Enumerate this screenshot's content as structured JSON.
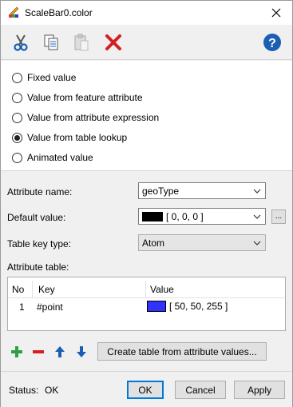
{
  "window": {
    "title": "ScaleBar0.color",
    "close_icon": "close-icon"
  },
  "toolbar": {
    "cut_icon": "scissors-icon",
    "copy_icon": "copy-icon",
    "paste_icon": "paste-icon",
    "delete_icon": "red-x-icon",
    "help_icon": "help-icon"
  },
  "value_source": {
    "options": [
      {
        "label": "Fixed value",
        "checked": false
      },
      {
        "label": "Value from feature attribute",
        "checked": false
      },
      {
        "label": "Value from attribute expression",
        "checked": false
      },
      {
        "label": "Value from table lookup",
        "checked": true
      },
      {
        "label": "Animated value",
        "checked": false
      }
    ]
  },
  "params": {
    "attribute_name_label": "Attribute name:",
    "attribute_name_value": "geoType",
    "default_value_label": "Default value:",
    "default_value_text": "[ 0, 0, 0 ]",
    "default_value_color": "#000000",
    "default_value_more": "...",
    "table_key_type_label": "Table key type:",
    "table_key_type_value": "Atom",
    "attribute_table_label": "Attribute table:"
  },
  "table": {
    "headers": [
      "No",
      "Key",
      "Value"
    ],
    "rows": [
      {
        "no": "1",
        "key": "#point",
        "value_text": "[ 50, 50, 255 ]",
        "value_color": "#3232ff"
      }
    ]
  },
  "table_actions": {
    "add_icon": "plus-icon",
    "remove_icon": "minus-icon",
    "up_icon": "arrow-up-icon",
    "down_icon": "arrow-down-icon",
    "create_label": "Create table from attribute values..."
  },
  "footer": {
    "status_label": "Status:",
    "status_value": "OK",
    "ok_label": "OK",
    "cancel_label": "Cancel",
    "apply_label": "Apply"
  }
}
